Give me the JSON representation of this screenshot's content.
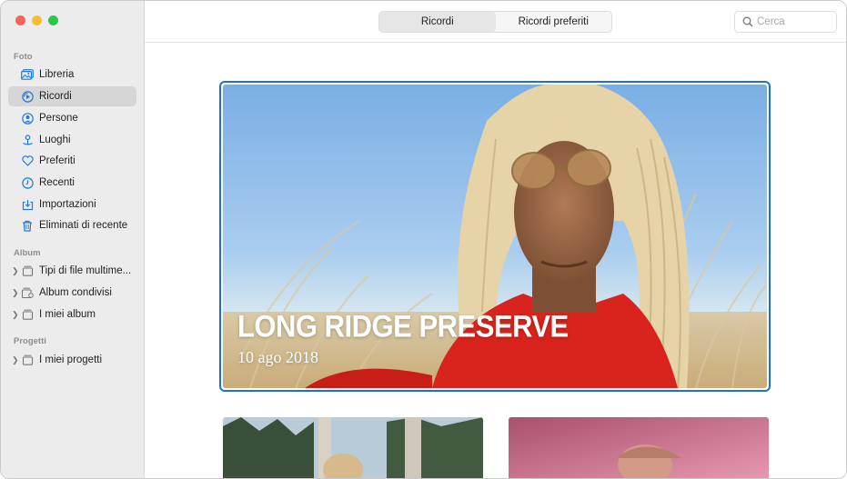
{
  "sidebar": {
    "sections": {
      "foto": "Foto",
      "album": "Album",
      "progetti": "Progetti"
    },
    "foto_items": [
      {
        "label": "Libreria",
        "icon": "photo-library-icon"
      },
      {
        "label": "Ricordi",
        "icon": "memories-icon",
        "selected": true
      },
      {
        "label": "Persone",
        "icon": "person-icon"
      },
      {
        "label": "Luoghi",
        "icon": "map-pin-icon"
      },
      {
        "label": "Preferiti",
        "icon": "heart-icon"
      },
      {
        "label": "Recenti",
        "icon": "clock-icon"
      },
      {
        "label": "Importazioni",
        "icon": "import-icon"
      },
      {
        "label": "Eliminati di recente",
        "icon": "trash-icon"
      }
    ],
    "album_items": [
      {
        "label": "Tipi di file multime..."
      },
      {
        "label": "Album condivisi"
      },
      {
        "label": "I miei album"
      }
    ],
    "progetti_items": [
      {
        "label": "I miei progetti"
      }
    ]
  },
  "toolbar": {
    "tabs": [
      "Ricordi",
      "Ricordi preferiti"
    ],
    "active_tab": "Ricordi",
    "search_placeholder": "Cerca"
  },
  "memory": {
    "title": "LONG RIDGE PRESERVE",
    "date": "10 ago 2018"
  },
  "colors": {
    "accent": "#1a6fe0",
    "sidebar_bg": "#ececec",
    "icon_blue": "#1f7ae0"
  }
}
